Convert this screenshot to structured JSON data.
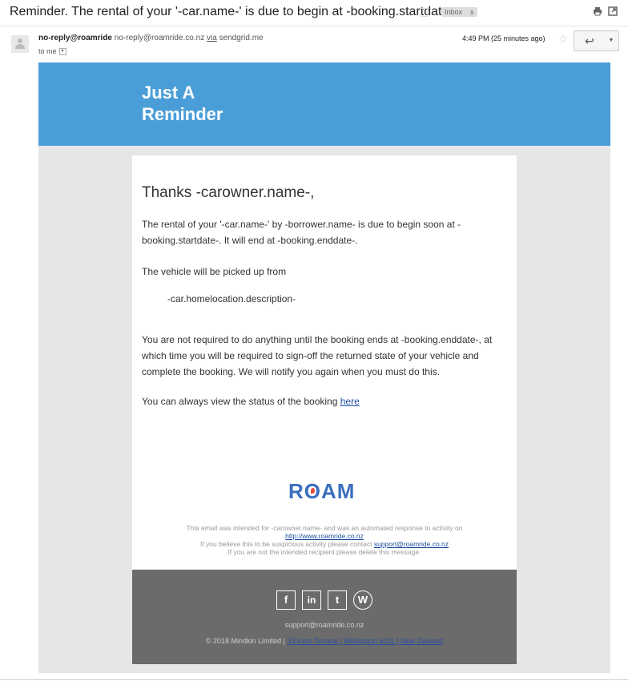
{
  "header": {
    "subject": "Reminder. The rental of your '-car.name-' is due to begin at -booking.startdate-.",
    "label_chip": "Inbox",
    "label_remove": "x",
    "print_icon": "print-icon",
    "newwindow_icon": "new-window-icon"
  },
  "message": {
    "sender_name": "no-reply@roamride",
    "sender_address": "no-reply@roamride.co.nz",
    "via_label": "via",
    "via_domain": "sendgrid.me",
    "to_label": "to me",
    "time": "4:49 PM (25 minutes ago)",
    "reply_icon": "reply-icon",
    "more_icon": "more-options-icon"
  },
  "email": {
    "banner_title_line1": "Just A",
    "banner_title_line2": "Reminder",
    "greeting": "Thanks -carowner.name-,",
    "para1": "The rental of your '-car.name-' by -borrower.name- is due to begin soon at -booking.startdate-. It will end at -booking.enddate-.",
    "para2": "The vehicle will be picked up from",
    "location": "-car.homelocation.description-",
    "para3": "You are not required to do anything until the booking ends at -booking.enddate-, at which time you will be required to sign-off the returned state of your vehicle and complete the booking. We will notify you again when you must do this.",
    "para4_prefix": "You can always view the status of the booking ",
    "para4_link": "here",
    "logo_text_r": "R",
    "logo_text_o": "O",
    "logo_text_am": "AM",
    "note1": "This email was intended for -carowner.name- and was an automated response to activity on",
    "note1_link": "http://www.roamride.co.nz",
    "note2_prefix": "If you believe this to be suspicious activity please contact ",
    "note2_link": "support@roamride.co.nz",
    "note3": "If you are not the intended recipient please delete this message."
  },
  "footer": {
    "social_facebook": "f",
    "social_linkedin": "in",
    "social_twitter": "t",
    "social_wordpress": "W",
    "support_email": "support@roamride.co.nz",
    "copyright": "© 2018 Mindkin Limited | ",
    "address": "33 Kent Terrace | Wellington 6011 | New Zealand"
  },
  "colors": {
    "banner": "#4a9ed8",
    "footer": "#6b6b6b",
    "brand": "#3b6fbe",
    "link": "#1a4fa0"
  }
}
